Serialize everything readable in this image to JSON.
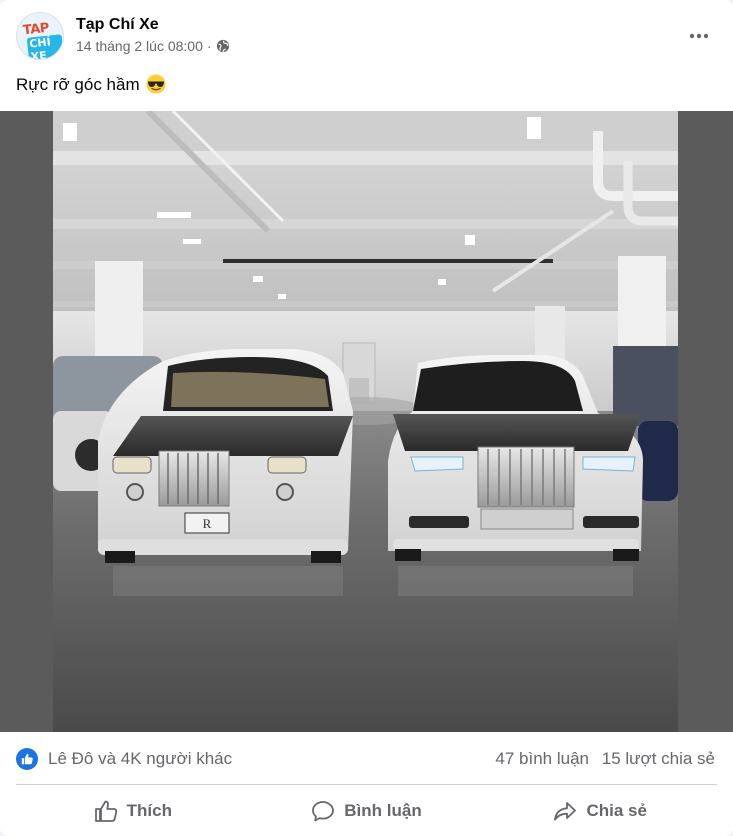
{
  "post": {
    "page_name": "Tạp Chí Xe",
    "avatar_text_top": "TAP",
    "avatar_text_bottom": "CHÍ XE",
    "timestamp": "14 tháng 2 lúc 08:00",
    "separator": "·",
    "caption": "Rực rỡ góc hầm",
    "caption_emoji": "smiling-face-with-sunglasses"
  },
  "stats": {
    "reactors": "Lê Đô và 4K người khác",
    "comments": "47 bình luận",
    "shares": "15 lượt chia sẻ"
  },
  "actions": {
    "like": "Thích",
    "comment": "Bình luận",
    "share": "Chia sẻ"
  },
  "colors": {
    "accent": "#1b74e4",
    "secondary_text": "#65676b",
    "media_background": "#5a5b5a"
  }
}
